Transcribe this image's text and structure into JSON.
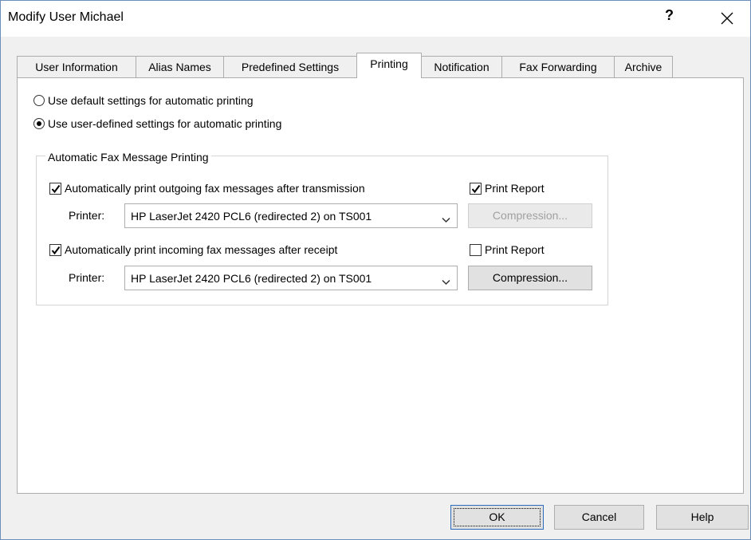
{
  "window": {
    "title": "Modify User Michael",
    "help_symbol": "?"
  },
  "tabs": [
    {
      "label": "User Information",
      "active": false
    },
    {
      "label": "Alias Names",
      "active": false
    },
    {
      "label": "Predefined Settings",
      "active": false
    },
    {
      "label": "Printing",
      "active": true
    },
    {
      "label": "Notification",
      "active": false
    },
    {
      "label": "Fax Forwarding",
      "active": false
    },
    {
      "label": "Archive",
      "active": false
    }
  ],
  "printing": {
    "radio_default": {
      "label": "Use default settings for automatic printing",
      "selected": false
    },
    "radio_user": {
      "label": "Use user-defined settings for automatic printing",
      "selected": true
    },
    "group_label": "Automatic Fax Message Printing",
    "outgoing": {
      "checkbox_label": "Automatically print outgoing fax messages after transmission",
      "checked": true,
      "printer_label": "Printer:",
      "printer_value": "HP LaserJet 2420 PCL6 (redirected 2) on TS001",
      "print_report_label": "Print Report",
      "print_report_checked": true,
      "compression_label": "Compression...",
      "compression_enabled": false
    },
    "incoming": {
      "checkbox_label": "Automatically print incoming fax messages after receipt",
      "checked": true,
      "printer_label": "Printer:",
      "printer_value": "HP LaserJet 2420 PCL6 (redirected 2) on TS001",
      "print_report_label": "Print Report",
      "print_report_checked": false,
      "compression_label": "Compression...",
      "compression_enabled": true
    }
  },
  "buttons": {
    "ok": "OK",
    "cancel": "Cancel",
    "help": "Help"
  },
  "icons": {
    "close": "close-icon",
    "dropdown": "chevron-down-icon",
    "check": "check-icon"
  },
  "colors": {
    "window_border": "#6b8fb8",
    "default_button_border": "#2d6bbd"
  }
}
